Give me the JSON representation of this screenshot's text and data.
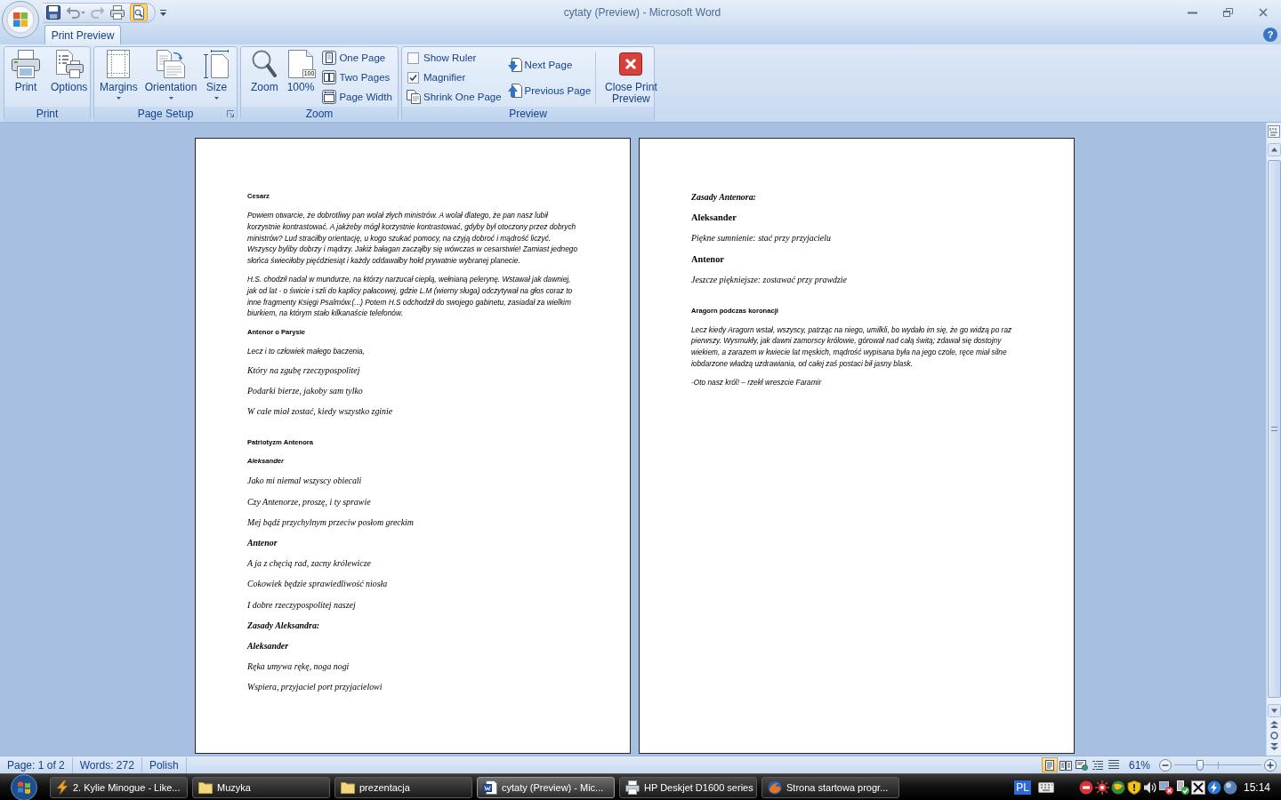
{
  "window": {
    "title": "cytaty (Preview) - Microsoft Word"
  },
  "tabs": [
    {
      "label": "Print Preview",
      "selected": true
    }
  ],
  "help": "?",
  "ribbon": {
    "groups": [
      {
        "label": "Print",
        "launcher": false,
        "controls": [
          {
            "kind": "large",
            "label": "Print",
            "dropdown": false
          },
          {
            "kind": "large",
            "label": "Options",
            "dropdown": false
          }
        ]
      },
      {
        "label": "Page Setup",
        "launcher": true,
        "controls": [
          {
            "kind": "large",
            "label": "Margins",
            "dropdown": true
          },
          {
            "kind": "large",
            "label": "Orientation",
            "dropdown": true
          },
          {
            "kind": "large",
            "label": "Size",
            "dropdown": true
          }
        ]
      },
      {
        "label": "Zoom",
        "launcher": false,
        "controls": [
          {
            "kind": "large",
            "label": "Zoom",
            "dropdown": false
          },
          {
            "kind": "large",
            "label": "100%",
            "dropdown": false,
            "badge": "100"
          },
          {
            "kind": "stack",
            "items": [
              {
                "kind": "small",
                "label": "One Page"
              },
              {
                "kind": "small",
                "label": "Two Pages"
              },
              {
                "kind": "small",
                "label": "Page Width"
              }
            ]
          }
        ]
      },
      {
        "label": "Preview",
        "launcher": false,
        "controls": [
          {
            "kind": "stack",
            "items": [
              {
                "kind": "check",
                "label": "Show Ruler",
                "checked": false
              },
              {
                "kind": "check",
                "label": "Magnifier",
                "checked": true
              },
              {
                "kind": "small",
                "label": "Shrink One Page"
              }
            ]
          },
          {
            "kind": "stack",
            "items": [
              {
                "kind": "small",
                "label": "Next Page"
              },
              {
                "kind": "small",
                "label": "Previous Page"
              }
            ]
          },
          {
            "kind": "separator"
          },
          {
            "kind": "large",
            "label": "Close Print Preview",
            "dropdown": false
          }
        ]
      }
    ]
  },
  "pages": [
    {
      "blocks": [
        {
          "kind": "heading",
          "text": "Cesarz"
        },
        {
          "kind": "prose",
          "text": "Powiem otwarcie, że dobrotliwy pan wolał złych ministrów. A wolał dlatego, że pan nasz lubił korzystnie kontrastować. A jakżeby mógł korzystnie kontrastować, gdyby był otoczony przez dobrych ministrów? Lud straciłby orientację, u kogo szukać pomocy, na czyją dobroć i mądrość liczyć. Wszyscy byliby dobrzy i mądrzy. Jakiż bałagan zacząłby się wówczas w cesarstwie! Zamiast jednego słońca świeciłoby pięćdziesiąt i każdy oddawałby hołd prywatnie wybranej planecie."
        },
        {
          "kind": "prose",
          "text": "H.S. chodził nadal w mundurze, na którzy narzucał ciepłą, wełnianą pelerynę. Wstawał jak dawniej, jak od lat - o świcie i szli do kaplicy pałacowej, gdzie L.M (wierny sługa) odczytywał na głos coraz to inne fragmenty Księgi Psalmów.(...) Potem H.S odchodził do swojego gabinetu, zasiadał za wielkim biurkiem, na którym stało kilkanaście telefonów."
        },
        {
          "kind": "heading",
          "text": "Antenor o Parysie"
        },
        {
          "kind": "prose",
          "text": "Lecz i to człowiek małego baczenia,"
        },
        {
          "kind": "verse",
          "text": "Który na zgubę rzeczypospolitej"
        },
        {
          "kind": "verse",
          "text": "Podarki bierze, jakoby sam tylko"
        },
        {
          "kind": "verse",
          "text": "W cale miał zostać, kiedy wszystko zginie"
        },
        {
          "kind": "heading",
          "text": "Patriotyzm Antenora"
        },
        {
          "kind": "label",
          "text": "Aleksander"
        },
        {
          "kind": "verse",
          "text": "Jako mi niemal wszyscy obiecali"
        },
        {
          "kind": "verse",
          "text": "Czy Antenorze, proszę, i ty sprawie"
        },
        {
          "kind": "verse",
          "text": "Mej bądź przychylnym przeciw posłom greckim"
        },
        {
          "kind": "speaker",
          "text": "Antenor"
        },
        {
          "kind": "verse",
          "text": "A ja z chęcią rad, zacny królewicze"
        },
        {
          "kind": "verse",
          "text": "Cokowiek będzie sprawiedliwość niosła"
        },
        {
          "kind": "verse",
          "text": "I dobre rzeczypospolitej naszej"
        },
        {
          "kind": "speaker",
          "text": "Zasady Aleksandra:"
        },
        {
          "kind": "speaker",
          "text": "Aleksander"
        },
        {
          "kind": "verse",
          "text": "Ręka umywa rękę, noga nogi"
        },
        {
          "kind": "verse",
          "text": "Wspiera, przyjaciel port przyjacielowi"
        }
      ]
    },
    {
      "blocks": [
        {
          "kind": "speaker",
          "text": "Zasady Antenora:"
        },
        {
          "kind": "name",
          "text": "Aleksander"
        },
        {
          "kind": "verse",
          "text": "Piękne sumnienie: stać przy przyjacielu"
        },
        {
          "kind": "name",
          "text": "Antenor"
        },
        {
          "kind": "verse",
          "text": "Jeszcze piękniejsze: zostawać przy prawdzie"
        },
        {
          "kind": "heading",
          "text": "Aragorn podczas koronacji"
        },
        {
          "kind": "prose",
          "text": "Lecz kiedy Aragorn wstał, wszyscy, patrząc na niego, umilkli, bo wydało im się, że go widzą po raz pierwszy. Wysmukły, jak dawni zamorscy królowie, górował nad całą świtą; zdawał się dostojny wiekiem, a zarazem w kwiecie lat męskich, mądrość wypisana była na jego czole, ręce miał silne iobdarzone władzą uzdrawiania, od całej zaś postaci bił jasny blask."
        },
        {
          "kind": "prose",
          "text": "-Oto nasz król! – rzekł wreszcie Faramir"
        }
      ]
    }
  ],
  "status_bar": {
    "items": [
      "Page: 1 of 2",
      "Words: 272",
      "Polish"
    ],
    "views": [
      {
        "selected": true
      },
      {
        "selected": false
      },
      {
        "selected": false
      },
      {
        "selected": false
      },
      {
        "selected": false
      }
    ],
    "zoom": {
      "label": "61%",
      "level": 0.3
    }
  },
  "taskbar": {
    "tasks": [
      {
        "label": "2. Kylie Minogue - Like...",
        "selected": false
      },
      {
        "label": "Muzyka",
        "selected": false
      },
      {
        "label": "prezentacja",
        "selected": false
      },
      {
        "label": "cytaty (Preview) - Mic...",
        "selected": true
      },
      {
        "label": "HP Deskjet D1600 series",
        "selected": false
      },
      {
        "label": "Strona startowa progr...",
        "selected": false
      }
    ],
    "language": "PL",
    "clock": "15:14"
  }
}
